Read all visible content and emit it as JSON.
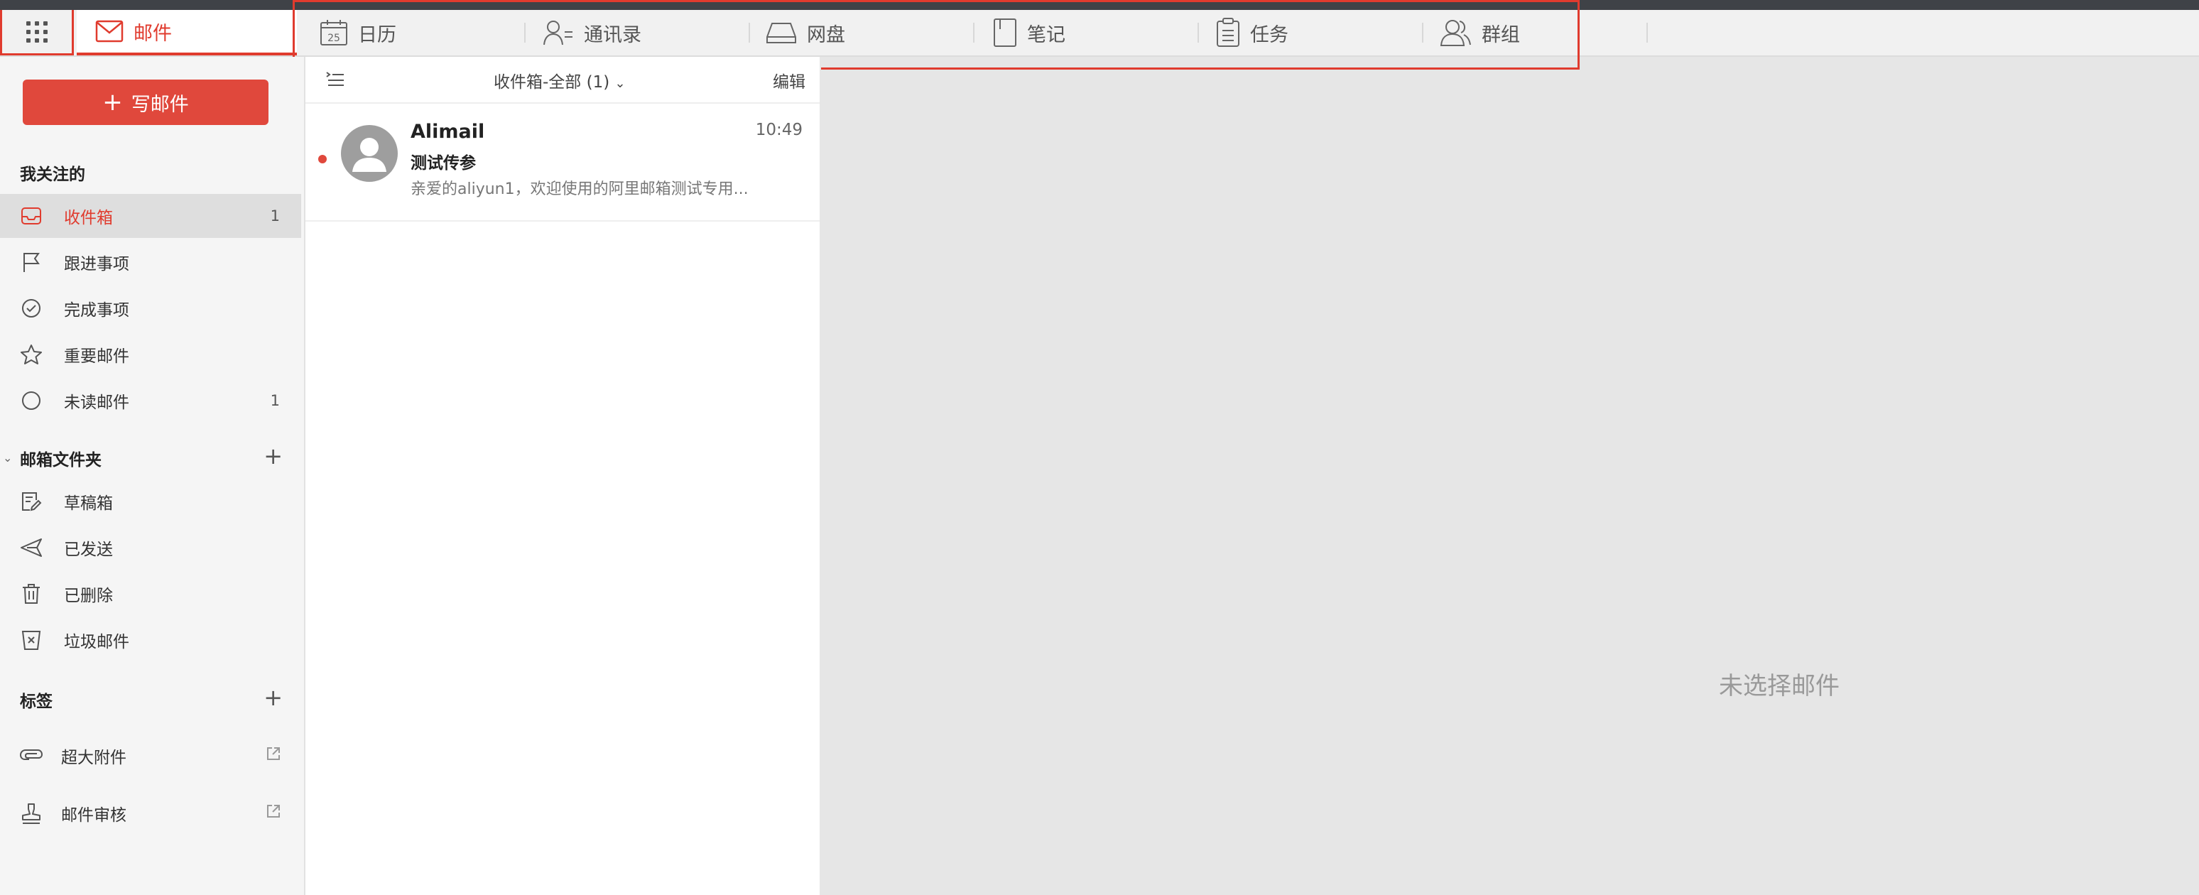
{
  "tabs": [
    {
      "id": "mail",
      "label": "邮件",
      "icon": "mail-icon",
      "active": true
    },
    {
      "id": "calendar",
      "label": "日历",
      "icon": "calendar-icon",
      "calendar_day": "25"
    },
    {
      "id": "contacts",
      "label": "通讯录",
      "icon": "contacts-icon"
    },
    {
      "id": "drive",
      "label": "网盘",
      "icon": "drive-icon"
    },
    {
      "id": "notes",
      "label": "笔记",
      "icon": "notes-icon"
    },
    {
      "id": "tasks",
      "label": "任务",
      "icon": "tasks-icon"
    },
    {
      "id": "groups",
      "label": "群组",
      "icon": "groups-icon"
    }
  ],
  "sidebar": {
    "compose_label": "写邮件",
    "favorites_title": "我关注的",
    "favorites": [
      {
        "label": "收件箱",
        "icon": "inbox-icon",
        "count": "1",
        "active": true
      },
      {
        "label": "跟进事项",
        "icon": "flag-icon",
        "count": ""
      },
      {
        "label": "完成事项",
        "icon": "check-circle-icon",
        "count": ""
      },
      {
        "label": "重要邮件",
        "icon": "star-icon",
        "count": ""
      },
      {
        "label": "未读邮件",
        "icon": "circle-icon",
        "count": "1"
      }
    ],
    "folders_title": "邮箱文件夹",
    "folders": [
      {
        "label": "草稿箱",
        "icon": "draft-icon"
      },
      {
        "label": "已发送",
        "icon": "send-icon"
      },
      {
        "label": "已删除",
        "icon": "trash-icon"
      },
      {
        "label": "垃圾邮件",
        "icon": "spam-icon"
      }
    ],
    "tags_title": "标签",
    "extras": [
      {
        "label": "超大附件",
        "icon": "paperclip-icon"
      },
      {
        "label": "邮件审核",
        "icon": "stamp-icon"
      }
    ]
  },
  "list": {
    "title": "收件箱-全部 (1)",
    "edit_label": "编辑",
    "mails": [
      {
        "sender": "Alimail",
        "time": "10:49",
        "subject": "测试传参",
        "preview": "亲爱的aliyun1，欢迎使用的阿里邮箱测试专用...",
        "unread": true
      }
    ]
  },
  "reading_pane": {
    "empty_text": "未选择邮件"
  },
  "colors": {
    "accent": "#e03b2e",
    "compose_bg": "#e0483c"
  }
}
